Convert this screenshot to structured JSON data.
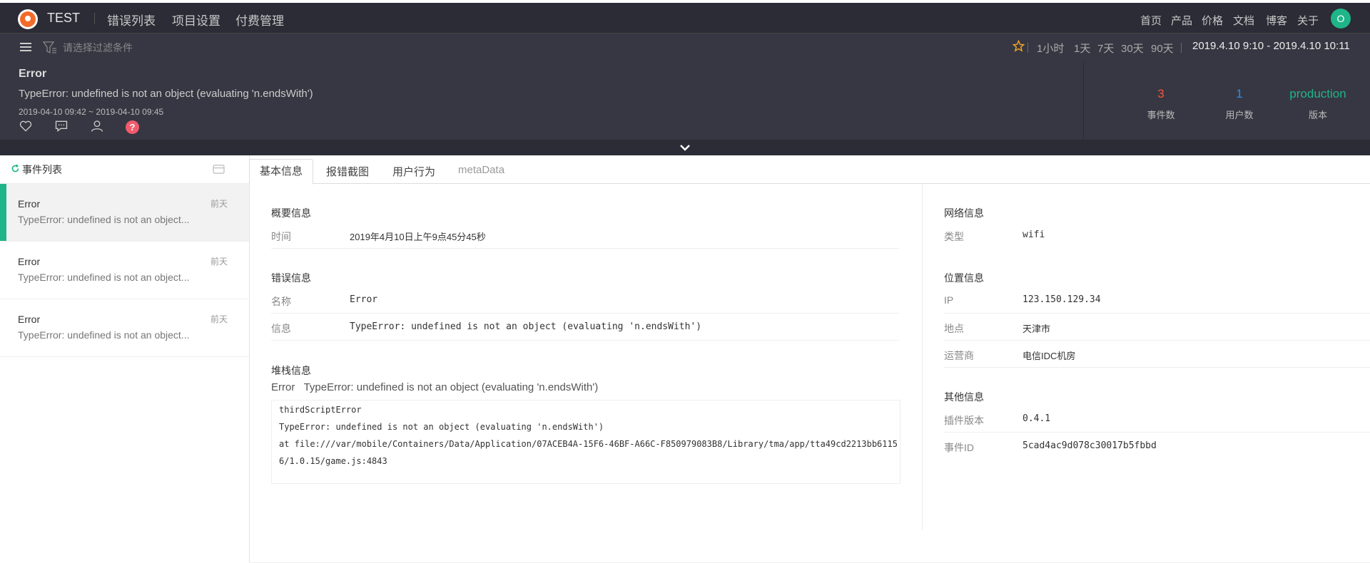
{
  "nav": {
    "brand": "TEST",
    "links": [
      "错误列表",
      "项目设置",
      "付费管理"
    ],
    "right_links": [
      "首页",
      "产品",
      "价格",
      "文档",
      "博客",
      "关于"
    ],
    "avatar": "O"
  },
  "filterbar": {
    "placeholder": "请选择过滤条件",
    "ranges": [
      "1小时",
      "1天",
      "7天",
      "30天",
      "90天"
    ],
    "date_from": "2019.4.10 9:10",
    "date_sep": "-",
    "date_to": "2019.4.10 10:11"
  },
  "summary": {
    "title": "Error",
    "message": "TypeError: undefined is not an object (evaluating 'n.endsWith')",
    "time_range": "2019-04-10 09:42 ~ 2019-04-10 09:45",
    "help": "?",
    "stats": [
      {
        "value": "3",
        "label": "事件数",
        "color": "#f5543e"
      },
      {
        "value": "1",
        "label": "用户数",
        "color": "#2d8cf0"
      },
      {
        "value": "production",
        "label": "版本",
        "color": "#1fb589"
      }
    ]
  },
  "events": {
    "title": "事件列表",
    "items": [
      {
        "title": "Error",
        "message": "TypeError: undefined is not an object...",
        "date": "前天"
      },
      {
        "title": "Error",
        "message": "TypeError: undefined is not an object...",
        "date": "前天"
      },
      {
        "title": "Error",
        "message": "TypeError: undefined is not an object...",
        "date": "前天"
      }
    ]
  },
  "tabs": [
    "基本信息",
    "报错截图",
    "用户行为",
    "metaData"
  ],
  "detail": {
    "overview_title": "概要信息",
    "time_label": "时间",
    "time_value": "2019年4月10日上午9点45分45秒",
    "error_title": "错误信息",
    "name_label": "名称",
    "name_value": "Error",
    "info_label": "信息",
    "info_value": "TypeError: undefined is not an object (evaluating 'n.endsWith')",
    "stack_title": "堆栈信息",
    "stack_head_name": "Error",
    "stack_head_msg": "TypeError: undefined is not an object (evaluating 'n.endsWith')",
    "stack_lines": [
      "thirdScriptError",
      "TypeError: undefined is not an object (evaluating 'n.endsWith')",
      "at file:///var/mobile/Containers/Data/Application/07ACEB4A-15F6-46BF-A66C-F850979083B8/Library/tma/app/tta49cd2213bb6115",
      "6/1.0.15/game.js:4843"
    ]
  },
  "side": {
    "network_title": "网络信息",
    "type_label": "类型",
    "type_value": "wifi",
    "location_title": "位置信息",
    "ip_label": "IP",
    "ip_value": "123.150.129.34",
    "place_label": "地点",
    "place_value": "天津市",
    "isp_label": "运营商",
    "isp_value": "电信IDC机房",
    "other_title": "其他信息",
    "plugin_label": "插件版本",
    "plugin_value": "0.4.1",
    "event_id_label": "事件ID",
    "event_id_value": "5cad4ac9d078c30017b5fbbd"
  }
}
